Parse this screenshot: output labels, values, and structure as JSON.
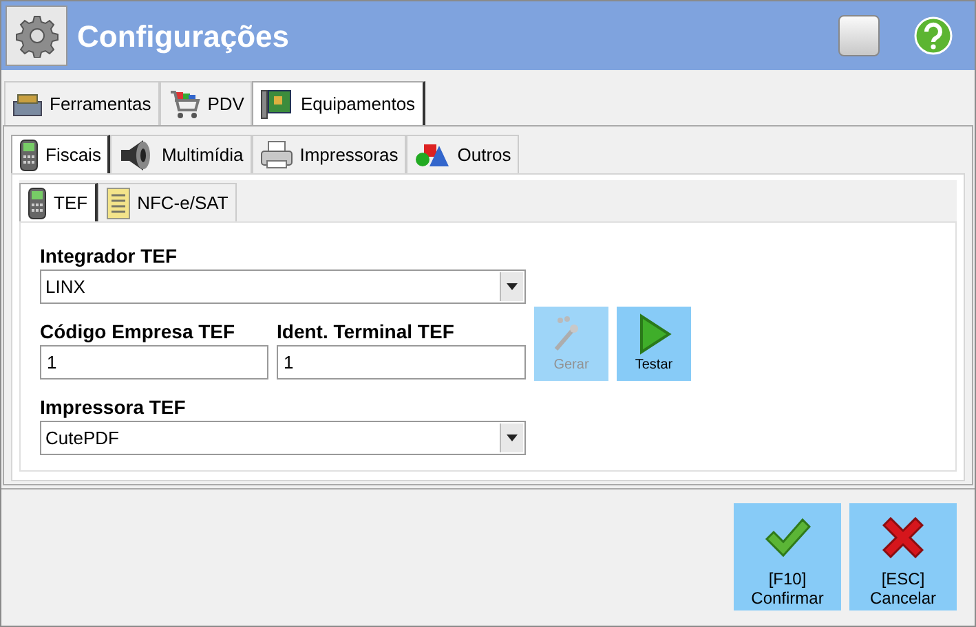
{
  "window": {
    "title": "Configurações"
  },
  "main_tabs": [
    {
      "label": "Ferramentas",
      "selected": false,
      "kind": "toolbox"
    },
    {
      "label": "PDV",
      "selected": false,
      "kind": "cart"
    },
    {
      "label": "Equipamentos",
      "selected": true,
      "kind": "board"
    }
  ],
  "sub_tabs": [
    {
      "label": "Fiscais",
      "selected": true,
      "kind": "terminal"
    },
    {
      "label": "Multimídia",
      "selected": false,
      "kind": "speaker"
    },
    {
      "label": "Impressoras",
      "selected": false,
      "kind": "printer"
    },
    {
      "label": "Outros",
      "selected": false,
      "kind": "shapes"
    }
  ],
  "inner_tabs": [
    {
      "label": "TEF",
      "selected": true,
      "kind": "terminal"
    },
    {
      "label": "NFC-e/SAT",
      "selected": false,
      "kind": "document"
    }
  ],
  "form": {
    "integrador": {
      "label": "Integrador TEF",
      "value": "LINX"
    },
    "codigo_empresa": {
      "label": "Código Empresa TEF",
      "value": "1"
    },
    "ident_terminal": {
      "label": "Ident. Terminal TEF",
      "value": "1"
    },
    "impressora": {
      "label": "Impressora TEF",
      "value": "CutePDF"
    },
    "actions": [
      {
        "label": "Gerar",
        "disabled": true,
        "kind": "wand"
      },
      {
        "label": "Testar",
        "disabled": false,
        "kind": "play"
      }
    ]
  },
  "footer_buttons": [
    {
      "shortcut": "[F10]",
      "label": "Confirmar",
      "kind": "confirm"
    },
    {
      "shortcut": "[ESC]",
      "label": "Cancelar",
      "kind": "cancel"
    }
  ]
}
